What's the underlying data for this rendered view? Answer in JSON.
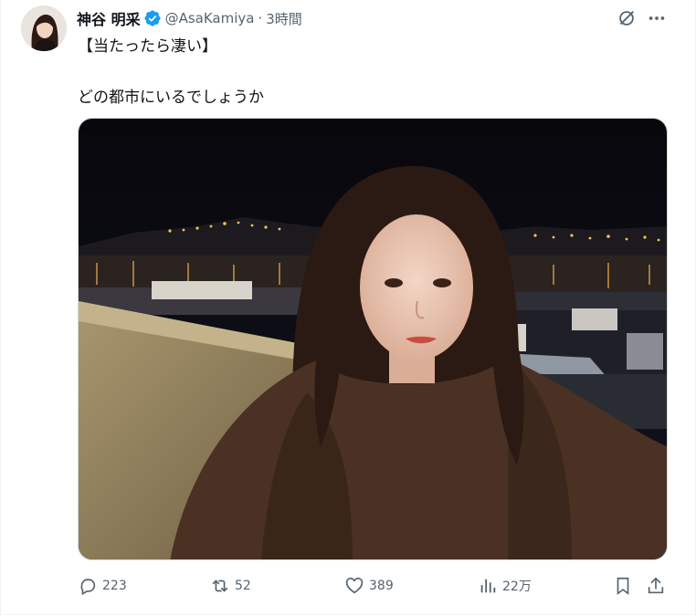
{
  "author": {
    "display_name": "神谷 明采",
    "handle": "@AsaKamiya",
    "separator": "·",
    "time": "3時間"
  },
  "tweet": {
    "line1": "【当たったら凄い】",
    "line2": "どの都市にいるでしょうか"
  },
  "actions": {
    "replies": "223",
    "reposts": "52",
    "likes": "389",
    "views": "22万"
  },
  "colors": {
    "verified": "#1d9bf0",
    "muted_text": "#536471",
    "night_sky": "#0b0b12",
    "city_lights": "#f5c15c",
    "jacket": "#4a3124"
  },
  "icons": [
    "grok-icon",
    "more-icon",
    "reply-icon",
    "repost-icon",
    "like-icon",
    "views-icon",
    "bookmark-icon",
    "share-icon",
    "verified-badge-icon"
  ]
}
